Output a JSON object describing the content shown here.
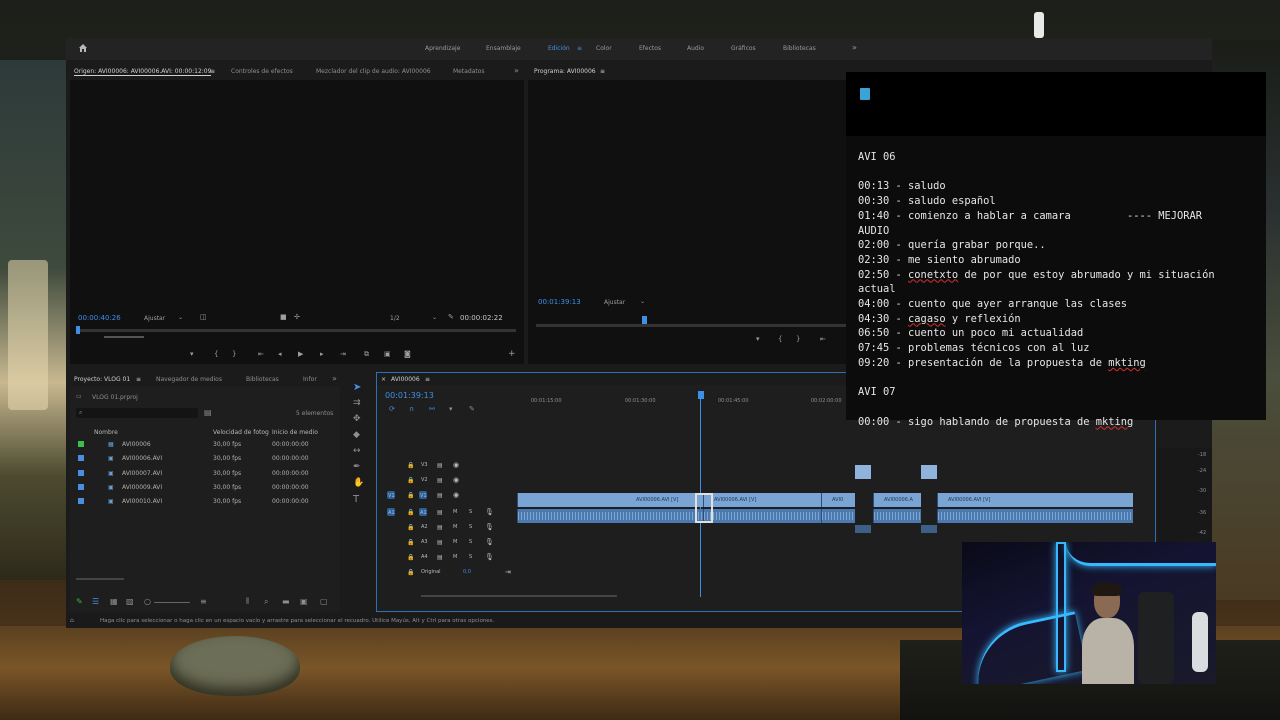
{
  "workspaces": [
    "Aprendizaje",
    "Ensamblaje",
    "Edición",
    "Color",
    "Efectos",
    "Audio",
    "Gráficos",
    "Bibliotecas"
  ],
  "active_workspace": "Edición",
  "source_monitor": {
    "tabs": [
      "Origen: AVI00006: AVI00006.AVI: 00:00:12:09",
      "Controles de efectos",
      "Mezclador del clip de audio: AVI00006",
      "Metadatos"
    ],
    "timecode_left": "00:00:40:26",
    "fit_label": "Ajustar",
    "resolution": "1/2",
    "timecode_right": "00:00:02:22"
  },
  "program_monitor": {
    "title": "Programa: AVI00006",
    "timecode": "00:01:39:13",
    "fit_label": "Ajustar"
  },
  "project_panel": {
    "tabs": [
      "Proyecto: VLOG 01",
      "Navegador de medios",
      "Bibliotecas",
      "Infor"
    ],
    "project_file": "VLOG 01.prproj",
    "items_count": "5 elementos",
    "columns": [
      "Nombre",
      "Velocidad de fotog",
      "Inicio de medio"
    ],
    "rows": [
      {
        "name": "AVI00006",
        "fps": "30,00 fps",
        "start": "00:00:00:00",
        "color": "#3bbf4a"
      },
      {
        "name": "AVI00006.AVI",
        "fps": "30,00 fps",
        "start": "00:00:00:00",
        "color": "#4a8ee0"
      },
      {
        "name": "AVI00007.AVI",
        "fps": "30,00 fps",
        "start": "00:00:00:00",
        "color": "#4a8ee0"
      },
      {
        "name": "AVI00009.AVI",
        "fps": "30,00 fps",
        "start": "00:00:00:00",
        "color": "#4a8ee0"
      },
      {
        "name": "AVI00010.AVI",
        "fps": "30,00 fps",
        "start": "00:00:00:00",
        "color": "#4a8ee0"
      }
    ]
  },
  "timeline": {
    "sequence_name": "AVI00006",
    "timecode": "00:01:39:13",
    "ruler": [
      "00:01:15:00",
      "00:01:30:00",
      "00:01:45:00",
      "00:02:00:00"
    ],
    "video_tracks": [
      "V3",
      "V2",
      "V1"
    ],
    "audio_tracks": [
      "A1",
      "A2",
      "A3",
      "A4"
    ],
    "source_patch_v": "V1",
    "source_patch_a": "A1",
    "master_label": "Original",
    "master_value": "0,0",
    "clips": [
      {
        "label": "AVI00006.AVI [V]"
      },
      {
        "label": "AVI00006.AVI [V]"
      },
      {
        "label": "AVI0"
      },
      {
        "label": "AVI00006.A"
      },
      {
        "label": "AVI00006.AVI [V]"
      }
    ]
  },
  "meter_labels": [
    "-18",
    "-24",
    "-30",
    "-36",
    "-42"
  ],
  "status_text": "Haga clic para seleccionar o haga clic en un espacio vacío y arrastre para seleccionar el recuadro. Utilice Mayús, Alt y Ctrl para otras opciones.",
  "notes": {
    "lines": [
      "AVI 06",
      "",
      "00:13 - saludo",
      "00:30 - saludo español",
      "01:40 - comienzo a hablar a camara         ---- MEJORAR",
      "AUDIO",
      "02:00 - quería grabar porque..",
      "02:30 - me siento abrumado",
      "02:50 - conetxto de por que estoy abrumado y mi situación",
      "actual",
      "04:00 - cuento que ayer arranque las clases",
      "04:30 - cagaso y reflexión",
      "06:50 - cuento un poco mi actualidad",
      "07:45 - problemas técnicos con al luz",
      "09:20 - presentación de la propuesta de mkting",
      "",
      "AVI 07",
      "",
      "00:00 - sigo hablando de propuesta de mkting"
    ]
  }
}
